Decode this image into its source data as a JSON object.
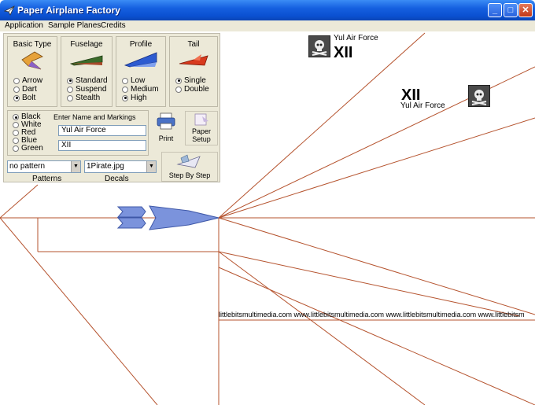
{
  "window": {
    "title": "Paper Airplane Factory",
    "buttons": {
      "minimize": "_",
      "maximize": "□",
      "close": "✕"
    }
  },
  "menu": [
    "Application",
    "Sample Planes",
    "Credits"
  ],
  "panel": {
    "basic_type": {
      "title": "Basic Type",
      "options": [
        "Arrow",
        "Dart",
        "Bolt"
      ],
      "selected": "Bolt"
    },
    "fuselage": {
      "title": "Fuselage",
      "options": [
        "Standard",
        "Suspend",
        "Stealth"
      ],
      "selected": "Standard"
    },
    "profile": {
      "title": "Profile",
      "options": [
        "Low",
        "Medium",
        "High"
      ],
      "selected": "High"
    },
    "tail": {
      "title": "Tail",
      "options": [
        "Single",
        "Double"
      ],
      "selected": "Single"
    },
    "colors": {
      "options": [
        "Black",
        "White",
        "Red",
        "Blue",
        "Green"
      ],
      "selected": "Black"
    },
    "markings": {
      "label": "Enter Name and Markings",
      "name": "Yul Air Force",
      "marking": "XII"
    },
    "print_label": "Print",
    "paper_setup_label": "Paper Setup",
    "step_by_step_label": "Step By Step",
    "pattern": {
      "value": "no pattern",
      "label": "Patterns"
    },
    "decal": {
      "value": "1Pirate.jpg",
      "label": "Decals"
    }
  },
  "canvas": {
    "decal_top": {
      "name": "Yul Air Force",
      "marking": "XII"
    },
    "decal_right": {
      "name": "Yul Air Force",
      "marking": "XII"
    },
    "watermark": "littlebitsmultimedia.com www.littlebitsmultimedia.com www.littlebitsmultimedia.com www.littlebitsm"
  }
}
